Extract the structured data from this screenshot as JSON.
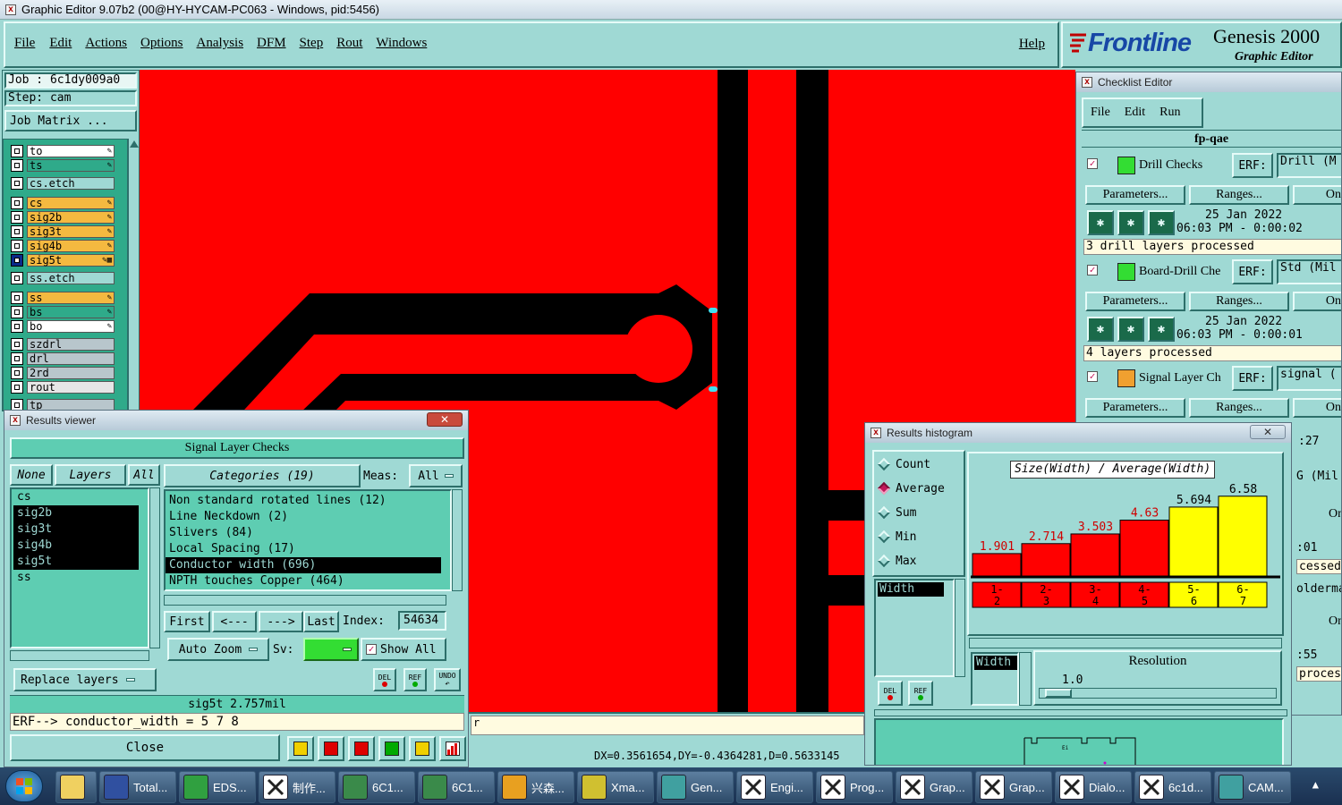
{
  "window_title": "Graphic Editor 9.07b2 (00@HY-HYCAM-PC063 - Windows, pid:5456)",
  "menu": {
    "items": [
      "File",
      "Edit",
      "Actions",
      "Options",
      "Analysis",
      "DFM",
      "Step",
      "Rout",
      "Windows"
    ],
    "help": "Help"
  },
  "brand": {
    "logo": "Frontline",
    "product": "Genesis 2000",
    "subtitle": "Graphic Editor"
  },
  "job": {
    "job_label": "Job : 6c1dy009a0",
    "step_label": "Step: cam",
    "matrix_button": "Job Matrix ..."
  },
  "layers": [
    {
      "name": "to",
      "color": "#ffffff"
    },
    {
      "name": "ts",
      "color": "#2faa8a"
    },
    {
      "name": "cs.etch",
      "color": "#9fd9d4"
    },
    {
      "name": "cs",
      "color": "#f4b940"
    },
    {
      "name": "sig2b",
      "color": "#f4b940"
    },
    {
      "name": "sig3t",
      "color": "#f4b940"
    },
    {
      "name": "sig4b",
      "color": "#f4b940"
    },
    {
      "name": "sig5t",
      "color": "#f4b940"
    },
    {
      "name": "ss.etch",
      "color": "#9fd9d4"
    },
    {
      "name": "ss",
      "color": "#f4b940"
    },
    {
      "name": "bs",
      "color": "#2faa8a"
    },
    {
      "name": "bo",
      "color": "#ffffff"
    },
    {
      "name": "szdrl",
      "color": "#b8c6cc"
    },
    {
      "name": "drl",
      "color": "#b8c6cc"
    },
    {
      "name": "2rd",
      "color": "#b8c6cc"
    },
    {
      "name": "rout",
      "color": "#e6e6e6"
    },
    {
      "name": "tp",
      "color": "#b8c6cc"
    }
  ],
  "status_bar": {
    "measure": "DX=0.3561654,DY=-0.4364281,D=0.5633145",
    "partial": "r"
  },
  "results_viewer": {
    "title": "Results viewer",
    "header": "Signal Layer Checks",
    "none_btn": "None",
    "layers_btn": "Layers",
    "all_btn": "All",
    "layer_list": [
      "cs",
      "sig2b",
      "sig3t",
      "sig4b",
      "sig5t",
      "ss"
    ],
    "replace_layers": "Replace layers",
    "categories_btn": "Categories (19)",
    "meas_label": "Meas:",
    "meas_value": "All",
    "categories": [
      "Non standard rotated lines (12)",
      "Line Neckdown (2)",
      "Slivers (84)",
      "Local Spacing (17)",
      "Conductor width (696)",
      "NPTH touches Copper (464)"
    ],
    "first": "First",
    "prev": "<---",
    "next": "--->",
    "last": "Last",
    "index_label": "Index:",
    "index_value": "54634",
    "auto_zoom": "Auto Zoom",
    "sv_label": "Sv:",
    "show_all": "Show All",
    "del": "DEL",
    "ref": "REF",
    "undo": "UNDO",
    "status1": "sig5t 2.757mil",
    "status2": "ERF--> conductor_width = 5 7 8",
    "close": "Close"
  },
  "checklist": {
    "title": "Checklist Editor",
    "menu": [
      "File",
      "Edit",
      "Run"
    ],
    "name": "fp-qae",
    "erf_label": "ERF:",
    "params_btn": "Parameters...",
    "ranges_btn": "Ranges...",
    "on_btn": "On",
    "entries": [
      {
        "name": "Drill Checks",
        "erf": "Drill (M",
        "date": "25 Jan 2022",
        "time": "06:03 PM - 0:00:02",
        "status": "3 drill layers processed"
      },
      {
        "name": "Board-Drill Che",
        "erf": "Std (Mil",
        "date": "25 Jan 2022",
        "time": "06:03 PM - 0:00:01",
        "status": "4 layers processed"
      },
      {
        "name": "Signal Layer Ch",
        "erf": "signal (",
        "date": "",
        "time": ":27",
        "status": ""
      }
    ],
    "side_fragments": [
      "G (Mil",
      "On",
      ":01",
      "cessed",
      "oldermas",
      "On",
      ":55",
      "proces"
    ]
  },
  "histogram": {
    "title": "Results histogram",
    "options": [
      "Count",
      "Average",
      "Sum",
      "Min",
      "Max"
    ],
    "selected_option": "Average",
    "width_list": "Width",
    "chart_title": "Size(Width) / Average(Width)",
    "bars": [
      {
        "label": "1.901",
        "range": [
          "1-",
          "2"
        ],
        "value": 1.901,
        "color": "#ff0000"
      },
      {
        "label": "2.714",
        "range": [
          "2-",
          "3"
        ],
        "value": 2.714,
        "color": "#ff0000"
      },
      {
        "label": "3.503",
        "range": [
          "3-",
          "4"
        ],
        "value": 3.503,
        "color": "#ff0000"
      },
      {
        "label": "4.63",
        "range": [
          "4-",
          "5"
        ],
        "value": 4.63,
        "color": "#ff0000"
      },
      {
        "label": "5.694",
        "range": [
          "5-",
          "6"
        ],
        "value": 5.694,
        "color": "#ffff00"
      },
      {
        "label": "6.58",
        "range": [
          "6-",
          "7"
        ],
        "value": 6.58,
        "color": "#ffff00"
      }
    ],
    "width_label": "Width",
    "resolution_label": "Resolution",
    "resolution_value": "1.0",
    "del": "DEL",
    "ref": "REF",
    "preview_text": "Ei"
  },
  "taskbar": [
    {
      "label": "",
      "color": "#f0d060"
    },
    {
      "label": "Total...",
      "color": "#3050a0"
    },
    {
      "label": "EDS...",
      "color": "#30a040"
    },
    {
      "label": "制作...",
      "color": "#ffffff"
    },
    {
      "label": "6C1...",
      "color": "#3a8a4a"
    },
    {
      "label": "6C1...",
      "color": "#3a8a4a"
    },
    {
      "label": "兴森...",
      "color": "#e8a020"
    },
    {
      "label": "Xma...",
      "color": "#d0c030"
    },
    {
      "label": "Gen...",
      "color": "#40a0a0"
    },
    {
      "label": "Engi...",
      "color": "#ffffff"
    },
    {
      "label": "Prog...",
      "color": "#ffffff"
    },
    {
      "label": "Grap...",
      "color": "#ffffff"
    },
    {
      "label": "Grap...",
      "color": "#ffffff"
    },
    {
      "label": "Dialo...",
      "color": "#ffffff"
    },
    {
      "label": "6c1d...",
      "color": "#ffffff"
    },
    {
      "label": "CAM...",
      "color": "#40a0a0"
    }
  ]
}
